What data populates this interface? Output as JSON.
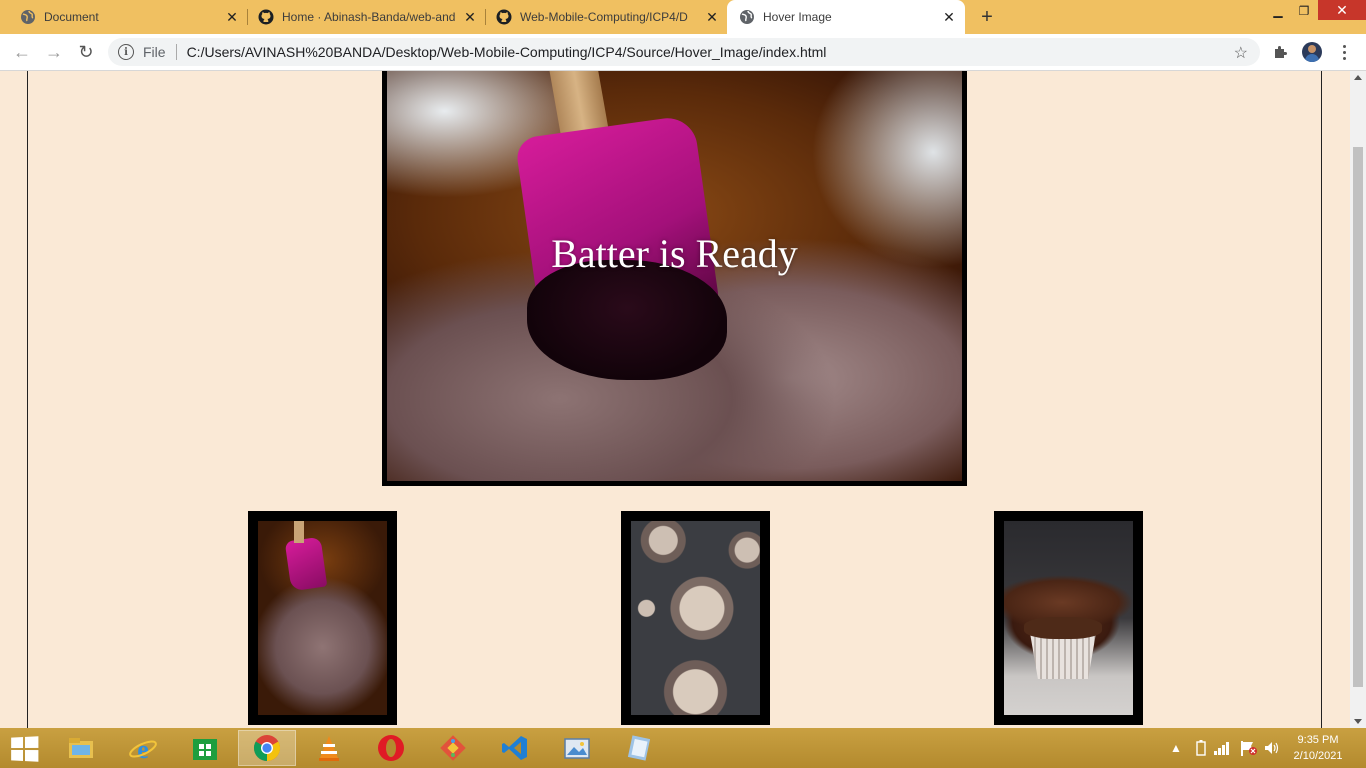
{
  "browser": {
    "tabs": [
      {
        "title": "Document",
        "icon": "globe-icon",
        "active": false
      },
      {
        "title": "Home · Abinash-Banda/web-and",
        "icon": "github-icon",
        "active": false
      },
      {
        "title": "Web-Mobile-Computing/ICP4/D",
        "icon": "github-icon",
        "active": false
      },
      {
        "title": "Hover Image",
        "icon": "globe-icon",
        "active": true
      }
    ],
    "new_tab_label": "+",
    "omnibox": {
      "scheme_label": "File",
      "url": "C:/Users/AVINASH%20BANDA/Desktop/Web-Mobile-Computing/ICP4/Source/Hover_Image/index.html"
    }
  },
  "page": {
    "main_image": {
      "overlay_text": "Batter is Ready",
      "subject": "chocolate batter with pink spatula"
    },
    "thumbnails": [
      {
        "subject": "chocolate batter in bowl"
      },
      {
        "subject": "batter in cupcake tins"
      },
      {
        "subject": "frosted chocolate cupcake"
      }
    ]
  },
  "taskbar": {
    "apps": [
      "file-explorer",
      "internet-explorer",
      "windows-store",
      "chrome",
      "vlc",
      "opera",
      "git-tool",
      "vscode",
      "photos",
      "notepad"
    ],
    "active_app": "chrome",
    "clock": {
      "time": "9:35 PM",
      "date": "2/10/2021"
    }
  },
  "colors": {
    "page_background": "#fae9d6",
    "tabstrip": "#f0c061",
    "taskbar": "#b38a2e",
    "close_button": "#c7362a"
  }
}
